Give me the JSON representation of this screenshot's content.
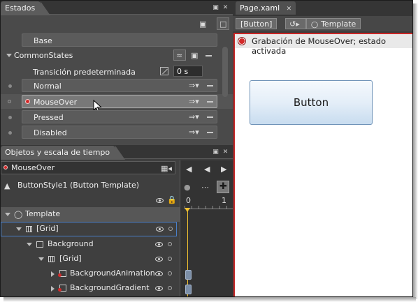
{
  "states_panel": {
    "title": "Estados",
    "base_label": "Base",
    "group": {
      "name": "CommonStates",
      "transition_label": "Transición predeterminada",
      "transition_value": "0 s"
    },
    "states": [
      {
        "label": "Normal",
        "recording": false,
        "selected": false
      },
      {
        "label": "MouseOver",
        "recording": true,
        "selected": true
      },
      {
        "label": "Pressed",
        "recording": false,
        "selected": false
      },
      {
        "label": "Disabled",
        "recording": false,
        "selected": false
      }
    ]
  },
  "objects_panel": {
    "title": "Objetos y escala de tiempo",
    "storyboard": "MouseOver",
    "scope": "ButtonStyle1 (Button Template)",
    "timeline_ticks": [
      "0",
      "1"
    ],
    "tree": [
      {
        "label": "Template",
        "depth": 0,
        "expanded": true
      },
      {
        "label": "[Grid]",
        "depth": 1,
        "expanded": true
      },
      {
        "label": "Background",
        "depth": 2,
        "expanded": true
      },
      {
        "label": "[Grid]",
        "depth": 3,
        "expanded": true
      },
      {
        "label": "BackgroundAnimation",
        "depth": 4,
        "expanded": false
      },
      {
        "label": "BackgroundGradient",
        "depth": 4,
        "expanded": false
      }
    ]
  },
  "document": {
    "tab": "Page.xaml",
    "breadcrumbs": [
      "[Button]",
      "Template"
    ],
    "recording_message": "Grabación de MouseOver; estado activada",
    "button_label": "Button"
  },
  "colors": {
    "recording_red": "#d42a2a",
    "selection_blue": "#4a7fc9",
    "playhead_yellow": "#f2c230"
  }
}
